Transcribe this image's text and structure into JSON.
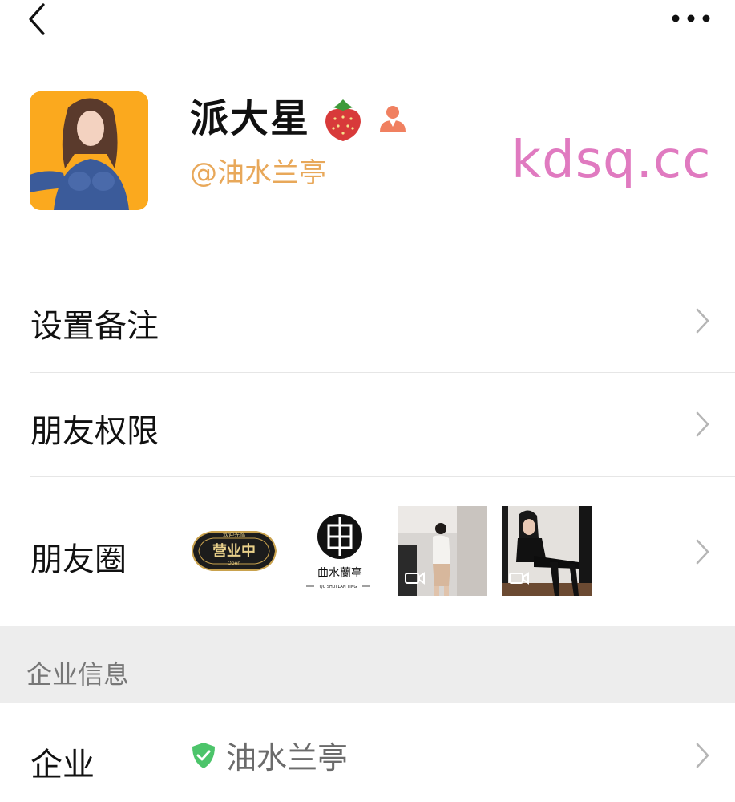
{
  "header": {
    "back_icon": "chevron-left-icon",
    "more_icon": "more-dots-icon"
  },
  "profile": {
    "name": "派大星",
    "handle": "@油水兰亭",
    "name_emoji_icon": "strawberry-icon",
    "badge_icon": "person-icon",
    "handle_color": "#e8a85a",
    "avatar_bg": "#fba91e"
  },
  "watermark": {
    "text": "kdsq.cc",
    "color": "#e07ac0"
  },
  "rows": {
    "remark": {
      "label": "设置备注"
    },
    "permissions": {
      "label": "朋友权限"
    },
    "moments": {
      "label": "朋友圈",
      "thumbnails": [
        {
          "type": "image",
          "text_top": "欢迎光临",
          "text_main": "营业中",
          "text_sub": "Open"
        },
        {
          "type": "image",
          "text_main": "曲水蘭亭",
          "text_sub": "QU SHUI LAN TING"
        },
        {
          "type": "video"
        },
        {
          "type": "video"
        }
      ]
    }
  },
  "section": {
    "title": "企业信息"
  },
  "company_row": {
    "label": "企业",
    "value": "油水兰亭",
    "verified_icon": "shield-check-icon",
    "verified_color": "#4cc46a"
  }
}
